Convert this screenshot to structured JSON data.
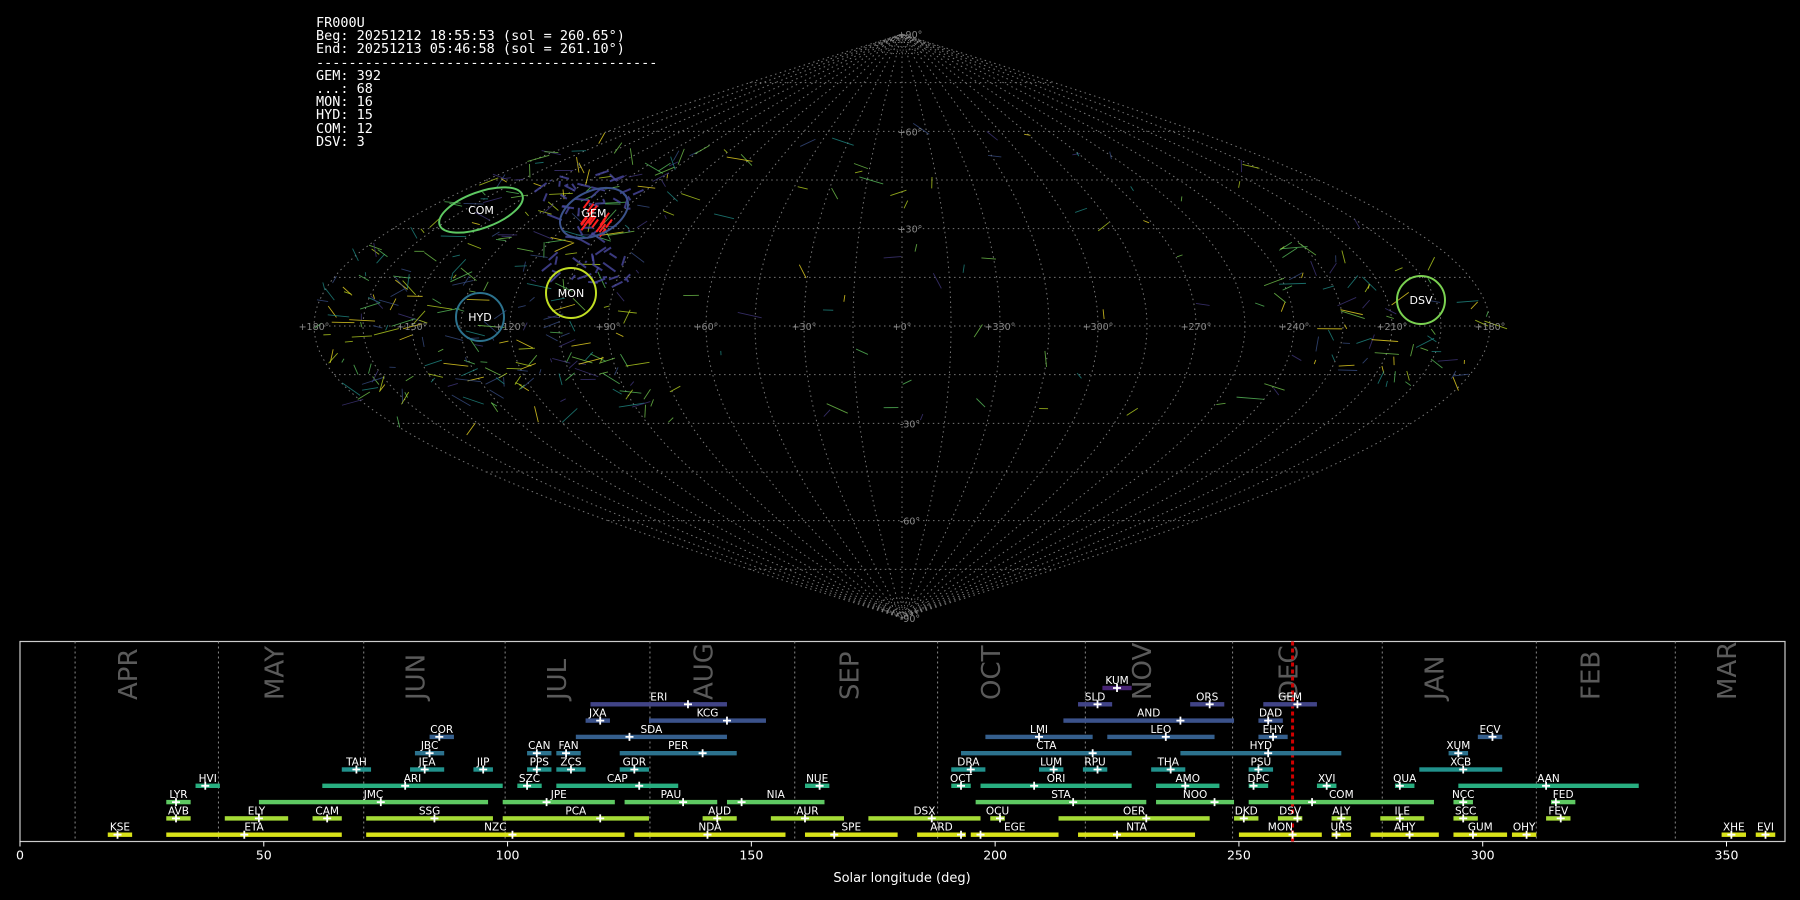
{
  "info": {
    "camera": "FR000U",
    "beg": "Beg: 20251212 18:55:53 (sol = 260.65°)",
    "end": "End: 20251213 05:46:58 (sol = 261.10°)",
    "separator": "------------------------------------------",
    "counts": [
      {
        "code": "GEM",
        "count": "392"
      },
      {
        "code": "...",
        "count": "68"
      },
      {
        "code": "MON",
        "count": "16"
      },
      {
        "code": "HYD",
        "count": "15"
      },
      {
        "code": "COM",
        "count": "12"
      },
      {
        "code": "DSV",
        "count": "3"
      }
    ]
  },
  "sky_map": {
    "projection": "sinusoidal",
    "lon_labels": [
      "+180°",
      "+150°",
      "+120°",
      "+90°",
      "+60°",
      "+30°",
      "+0°",
      "+330°",
      "+300°",
      "+270°",
      "+240°",
      "+210°",
      "+180°"
    ],
    "lat_labels": [
      "+90°",
      "+60°",
      "+30°",
      "-30°",
      "-60°",
      "-90°"
    ],
    "radiants": [
      {
        "code": "COM",
        "lon": 160,
        "lat": 32,
        "color": "#5ec962"
      },
      {
        "code": "GEM",
        "lon": 113,
        "lat": 33,
        "color": "#3b528b"
      },
      {
        "code": "MON",
        "lon": 102,
        "lat": 9,
        "color": "#c2df23"
      },
      {
        "code": "HYD",
        "lon": 127,
        "lat": 1,
        "color": "#2c728e"
      },
      {
        "code": "DSV",
        "lon": 204,
        "lat": 7,
        "color": "#7ad151"
      }
    ]
  },
  "chart_data": {
    "type": "timeline",
    "xlabel": "Solar longitude (deg)",
    "xlim": [
      0,
      362
    ],
    "xticks": [
      0,
      50,
      100,
      150,
      200,
      250,
      300,
      350
    ],
    "months": [
      {
        "name": "APR",
        "start": 11.3,
        "label_at": 24
      },
      {
        "name": "MAY",
        "start": 40.7,
        "label_at": 54
      },
      {
        "name": "JUN",
        "start": 70.5,
        "label_at": 83
      },
      {
        "name": "JUL",
        "start": 99.5,
        "label_at": 112
      },
      {
        "name": "AUG",
        "start": 129.2,
        "label_at": 142
      },
      {
        "name": "SEP",
        "start": 158.9,
        "label_at": 172
      },
      {
        "name": "OCT",
        "start": 188.2,
        "label_at": 201
      },
      {
        "name": "NOV",
        "start": 218.5,
        "label_at": 232
      },
      {
        "name": "DEC",
        "start": 248.7,
        "label_at": 262
      },
      {
        "name": "JAN",
        "start": 279.4,
        "label_at": 292
      },
      {
        "name": "FEB",
        "start": 311.0,
        "label_at": 324
      },
      {
        "name": "MAR",
        "start": 339.5,
        "label_at": 352
      }
    ],
    "current_sol": 261,
    "showers": [
      {
        "code": "KUM",
        "start": 222,
        "end": 228,
        "peak": 225,
        "level": 0
      },
      {
        "code": "SLD",
        "start": 217,
        "end": 224,
        "peak": 221,
        "level": 1
      },
      {
        "code": "ORS",
        "start": 240,
        "end": 247,
        "peak": 244,
        "level": 1
      },
      {
        "code": "GEM",
        "start": 255,
        "end": 266,
        "peak": 262,
        "level": 1
      },
      {
        "code": "ERI",
        "start": 117,
        "end": 145,
        "peak": 137,
        "level": 1
      },
      {
        "code": "JXA",
        "start": 116,
        "end": 121,
        "peak": 119,
        "level": 2
      },
      {
        "code": "KCG",
        "start": 129,
        "end": 153,
        "peak": 145,
        "level": 2
      },
      {
        "code": "AND",
        "start": 214,
        "end": 249,
        "peak": 238,
        "level": 2
      },
      {
        "code": "DAD",
        "start": 254,
        "end": 259,
        "peak": 256,
        "level": 2
      },
      {
        "code": "COR",
        "start": 84,
        "end": 89,
        "peak": 86,
        "level": 3
      },
      {
        "code": "SDA",
        "start": 114,
        "end": 145,
        "peak": 125,
        "level": 3
      },
      {
        "code": "LMI",
        "start": 198,
        "end": 220,
        "peak": 209,
        "level": 3
      },
      {
        "code": "LEO",
        "start": 223,
        "end": 245,
        "peak": 235,
        "level": 3
      },
      {
        "code": "EHY",
        "start": 254,
        "end": 260,
        "peak": 257,
        "level": 3
      },
      {
        "code": "ECV",
        "start": 299,
        "end": 304,
        "peak": 302,
        "level": 3
      },
      {
        "code": "JBC",
        "start": 81,
        "end": 87,
        "peak": 84,
        "level": 4
      },
      {
        "code": "CAN",
        "start": 104,
        "end": 109,
        "peak": 106,
        "level": 4
      },
      {
        "code": "FAN",
        "start": 110,
        "end": 115,
        "peak": 112,
        "level": 4
      },
      {
        "code": "PER",
        "start": 123,
        "end": 147,
        "peak": 140,
        "level": 4
      },
      {
        "code": "CTA",
        "start": 193,
        "end": 228,
        "peak": 220,
        "level": 4
      },
      {
        "code": "HYD",
        "start": 238,
        "end": 271,
        "peak": 256,
        "level": 4
      },
      {
        "code": "XUM",
        "start": 293,
        "end": 297,
        "peak": 295,
        "level": 4
      },
      {
        "code": "TAH",
        "start": 66,
        "end": 72,
        "peak": 69,
        "level": 5
      },
      {
        "code": "JEA",
        "start": 80,
        "end": 87,
        "peak": 83,
        "level": 5
      },
      {
        "code": "JIP",
        "start": 93,
        "end": 97,
        "peak": 95,
        "level": 5
      },
      {
        "code": "PPS",
        "start": 104,
        "end": 109,
        "peak": 106,
        "level": 5
      },
      {
        "code": "ZCS",
        "start": 110,
        "end": 116,
        "peak": 113,
        "level": 5
      },
      {
        "code": "GDR",
        "start": 123,
        "end": 129,
        "peak": 126,
        "level": 5
      },
      {
        "code": "DRA",
        "start": 191,
        "end": 198,
        "peak": 195,
        "level": 5
      },
      {
        "code": "LUM",
        "start": 209,
        "end": 214,
        "peak": 212,
        "level": 5
      },
      {
        "code": "RPU",
        "start": 218,
        "end": 223,
        "peak": 221,
        "level": 5
      },
      {
        "code": "THA",
        "start": 232,
        "end": 239,
        "peak": 236,
        "level": 5
      },
      {
        "code": "PSU",
        "start": 252,
        "end": 257,
        "peak": 254,
        "level": 5
      },
      {
        "code": "XCB",
        "start": 287,
        "end": 304,
        "peak": 296,
        "level": 5
      },
      {
        "code": "HVI",
        "start": 36,
        "end": 41,
        "peak": 38,
        "level": 6
      },
      {
        "code": "ARI",
        "start": 62,
        "end": 99,
        "peak": 79,
        "level": 6
      },
      {
        "code": "SZC",
        "start": 102,
        "end": 107,
        "peak": 104,
        "level": 6
      },
      {
        "code": "CAP",
        "start": 110,
        "end": 135,
        "peak": 127,
        "level": 6
      },
      {
        "code": "NUE",
        "start": 161,
        "end": 166,
        "peak": 164,
        "level": 6
      },
      {
        "code": "OCT",
        "start": 191,
        "end": 195,
        "peak": 193,
        "level": 6
      },
      {
        "code": "ORI",
        "start": 197,
        "end": 228,
        "peak": 208,
        "level": 6
      },
      {
        "code": "AMO",
        "start": 233,
        "end": 246,
        "peak": 239,
        "level": 6
      },
      {
        "code": "DPC",
        "start": 252,
        "end": 256,
        "peak": 253,
        "level": 6
      },
      {
        "code": "XVI",
        "start": 266,
        "end": 270,
        "peak": 268,
        "level": 6
      },
      {
        "code": "QUA",
        "start": 282,
        "end": 286,
        "peak": 283,
        "level": 6
      },
      {
        "code": "AAN",
        "start": 295,
        "end": 332,
        "peak": 313,
        "level": 6
      },
      {
        "code": "LYR",
        "start": 30,
        "end": 35,
        "peak": 32,
        "level": 7
      },
      {
        "code": "JMC",
        "start": 49,
        "end": 96,
        "peak": 74,
        "level": 7
      },
      {
        "code": "JPE",
        "start": 99,
        "end": 122,
        "peak": 108,
        "level": 7
      },
      {
        "code": "PAU",
        "start": 124,
        "end": 143,
        "peak": 136,
        "level": 7
      },
      {
        "code": "NIA",
        "start": 145,
        "end": 165,
        "peak": 148,
        "level": 7
      },
      {
        "code": "STA",
        "start": 196,
        "end": 231,
        "peak": 216,
        "level": 7
      },
      {
        "code": "NOO",
        "start": 233,
        "end": 249,
        "peak": 245,
        "level": 7
      },
      {
        "code": "COM",
        "start": 252,
        "end": 290,
        "peak": 265,
        "level": 7
      },
      {
        "code": "NCC",
        "start": 294,
        "end": 298,
        "peak": 296,
        "level": 7
      },
      {
        "code": "FED",
        "start": 314,
        "end": 319,
        "peak": 315,
        "level": 7
      },
      {
        "code": "AVB",
        "start": 30,
        "end": 35,
        "peak": 32,
        "level": 8
      },
      {
        "code": "ELY",
        "start": 42,
        "end": 55,
        "peak": 49,
        "level": 8
      },
      {
        "code": "CAM",
        "start": 60,
        "end": 66,
        "peak": 63,
        "level": 8
      },
      {
        "code": "SSG",
        "start": 71,
        "end": 97,
        "peak": 85,
        "level": 8
      },
      {
        "code": "PCA",
        "start": 99,
        "end": 129,
        "peak": 119,
        "level": 8
      },
      {
        "code": "AUD",
        "start": 140,
        "end": 147,
        "peak": 143,
        "level": 8
      },
      {
        "code": "AUR",
        "start": 154,
        "end": 169,
        "peak": 161,
        "level": 8
      },
      {
        "code": "DSX",
        "start": 174,
        "end": 197,
        "peak": 187,
        "level": 8
      },
      {
        "code": "OCU",
        "start": 199,
        "end": 202,
        "peak": 201,
        "level": 8
      },
      {
        "code": "OER",
        "start": 213,
        "end": 244,
        "peak": 231,
        "level": 8
      },
      {
        "code": "DKD",
        "start": 249,
        "end": 254,
        "peak": 251,
        "level": 8
      },
      {
        "code": "DSV",
        "start": 258,
        "end": 263,
        "peak": 262,
        "level": 8
      },
      {
        "code": "ALY",
        "start": 269,
        "end": 273,
        "peak": 271,
        "level": 8
      },
      {
        "code": "ILE",
        "start": 279,
        "end": 288,
        "peak": 283,
        "level": 8
      },
      {
        "code": "SCC",
        "start": 294,
        "end": 299,
        "peak": 296,
        "level": 8
      },
      {
        "code": "FEV",
        "start": 313,
        "end": 318,
        "peak": 316,
        "level": 8
      },
      {
        "code": "KSE",
        "start": 18,
        "end": 23,
        "peak": 20,
        "level": 9
      },
      {
        "code": "ETA",
        "start": 30,
        "end": 66,
        "peak": 46,
        "level": 9
      },
      {
        "code": "NZC",
        "start": 71,
        "end": 124,
        "peak": 101,
        "level": 9
      },
      {
        "code": "NDA",
        "start": 126,
        "end": 157,
        "peak": 141,
        "level": 9
      },
      {
        "code": "SPE",
        "start": 161,
        "end": 180,
        "peak": 167,
        "level": 9
      },
      {
        "code": "ARD",
        "start": 184,
        "end": 194,
        "peak": 193,
        "level": 9
      },
      {
        "code": "EGE",
        "start": 195,
        "end": 213,
        "peak": 197,
        "level": 9
      },
      {
        "code": "NTA",
        "start": 217,
        "end": 241,
        "peak": 225,
        "level": 9
      },
      {
        "code": "MON",
        "start": 250,
        "end": 267,
        "peak": 261,
        "level": 9
      },
      {
        "code": "URS",
        "start": 269,
        "end": 273,
        "peak": 270,
        "level": 9
      },
      {
        "code": "AHY",
        "start": 277,
        "end": 291,
        "peak": 285,
        "level": 9
      },
      {
        "code": "GUM",
        "start": 294,
        "end": 305,
        "peak": 298,
        "level": 9
      },
      {
        "code": "OHY",
        "start": 306,
        "end": 311,
        "peak": 309,
        "level": 9
      },
      {
        "code": "XHE",
        "start": 349,
        "end": 354,
        "peak": 351,
        "level": 9
      },
      {
        "code": "EVI",
        "start": 356,
        "end": 360,
        "peak": 358,
        "level": 9
      }
    ]
  }
}
